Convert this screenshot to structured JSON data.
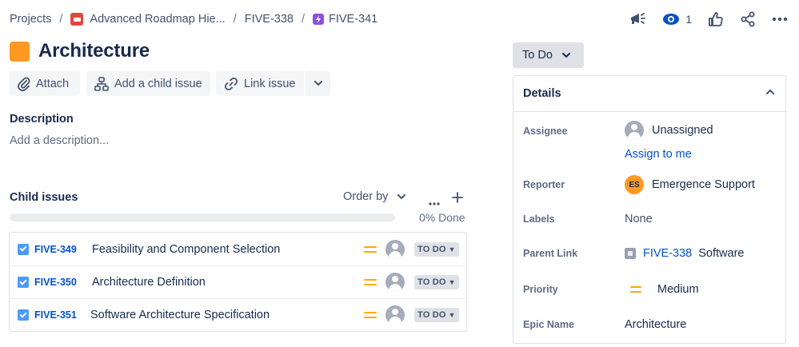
{
  "breadcrumb": {
    "projects": "Projects",
    "project_name": "Advanced Roadmap Hie...",
    "parent_key": "FIVE-338",
    "current_key": "FIVE-341",
    "separator": "/"
  },
  "header": {
    "watch_count": "1",
    "icons": [
      "megaphone-icon",
      "eye-icon",
      "thumbs-up-icon",
      "share-icon",
      "more-icon"
    ]
  },
  "issue": {
    "type_icon": "epic-icon",
    "title": "Architecture"
  },
  "actions": {
    "attach": "Attach",
    "add_child": "Add a child issue",
    "link_issue": "Link issue"
  },
  "description": {
    "label": "Description",
    "placeholder": "Add a description..."
  },
  "child_issues": {
    "label": "Child issues",
    "order_by": "Order by",
    "progress_done_fraction": 0,
    "progress_text": "0% Done",
    "items": [
      {
        "key": "FIVE-349",
        "summary": "Feasibility and Component Selection",
        "status": "TO DO"
      },
      {
        "key": "FIVE-350",
        "summary": "Architecture Definition",
        "status": "TO DO"
      },
      {
        "key": "FIVE-351",
        "summary": "Software Architecture Specification",
        "status": "TO DO"
      }
    ]
  },
  "status_button": {
    "label": "To Do"
  },
  "details": {
    "title": "Details",
    "assignee_label": "Assignee",
    "assignee_value": "Unassigned",
    "assign_to_me": "Assign to me",
    "reporter_label": "Reporter",
    "reporter_initials": "ES",
    "reporter_value": "Emergence Support",
    "labels_label": "Labels",
    "labels_value": "None",
    "parent_link_label": "Parent Link",
    "parent_link_key": "FIVE-338",
    "parent_link_name": "Software",
    "priority_label": "Priority",
    "priority_value": "Medium",
    "epic_name_label": "Epic Name",
    "epic_name_value": "Architecture"
  },
  "colors": {
    "link": "#0052cc",
    "epic": "#ff991f",
    "subtask": "#904ee2",
    "project": "#e2483d",
    "priority_medium": "#ffab00",
    "story": "#4c9aff"
  }
}
